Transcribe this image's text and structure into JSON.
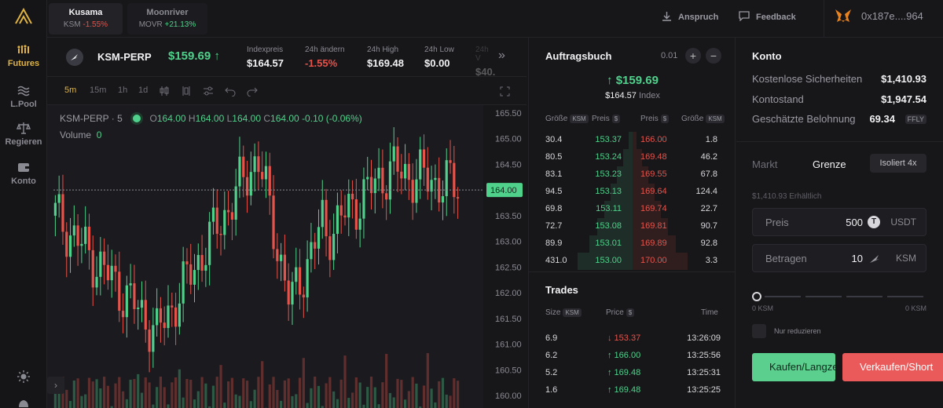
{
  "nav": {
    "futures": "Futures",
    "lpool": "L.Pool",
    "govern": "Regieren",
    "account": "Konto"
  },
  "markets": [
    {
      "name": "Kusama",
      "symbol": "KSM",
      "change": "-1.55%"
    },
    {
      "name": "Moonriver",
      "symbol": "MOVR",
      "change": "+21.13%"
    }
  ],
  "topbar": {
    "claim": "Anspruch",
    "feedback": "Feedback",
    "wallet": "0x187e....964"
  },
  "instrument": {
    "name": "KSM-PERP",
    "price": "$159.69",
    "stats": [
      {
        "label": "Indexpreis",
        "value": "$164.57"
      },
      {
        "label": "24h ändern",
        "value": "-1.55%"
      },
      {
        "label": "24h High",
        "value": "$169.48"
      },
      {
        "label": "24h Low",
        "value": "$0.00"
      },
      {
        "label": "24h V",
        "value": "$40."
      }
    ]
  },
  "chart_toolbar": {
    "timeframes": [
      "5m",
      "15m",
      "1h",
      "1d"
    ]
  },
  "chart": {
    "legend_title": "KSM-PERP · 5",
    "o": "164.00",
    "h": "164.00",
    "l": "164.00",
    "c": "164.00",
    "change": "-0.10 (-0.06%)",
    "volume_label": "Volume",
    "volume_value": "0",
    "current_price_label": "164.00"
  },
  "chart_data": {
    "type": "candlestick",
    "ylim": [
      160.0,
      165.5
    ],
    "yticks": [
      "165.50",
      "165.00",
      "164.50",
      "164.00",
      "163.50",
      "163.00",
      "162.50",
      "162.00",
      "161.50",
      "161.00",
      "160.50",
      "160.00"
    ],
    "last_price": 164.0
  },
  "orderbook": {
    "title": "Auftragsbuch",
    "tick": "0.01",
    "mid_price": "↑ $159.69",
    "index_price": "$164.57",
    "index_label": "Index",
    "headers": {
      "size": "Größe",
      "price": "Preis",
      "unit_ksm": "KSM",
      "unit_usd": "$"
    },
    "rows": [
      {
        "bid_size": "30.4",
        "bid_price": "153.37",
        "ask_price": "166.00",
        "ask_size": "1.8",
        "depth": 0.05
      },
      {
        "bid_size": "80.5",
        "bid_price": "153.24",
        "ask_price": "169.48",
        "ask_size": "46.2",
        "depth": 0.12
      },
      {
        "bid_size": "83.1",
        "bid_price": "153.23",
        "ask_price": "169.55",
        "ask_size": "67.8",
        "depth": 0.2
      },
      {
        "bid_size": "94.5",
        "bid_price": "153.13",
        "ask_price": "169.64",
        "ask_size": "124.4",
        "depth": 0.28
      },
      {
        "bid_size": "69.8",
        "bid_price": "153.11",
        "ask_price": "169.74",
        "ask_size": "22.7",
        "depth": 0.36
      },
      {
        "bid_size": "72.7",
        "bid_price": "153.08",
        "ask_price": "169.81",
        "ask_size": "90.7",
        "depth": 0.45
      },
      {
        "bid_size": "89.9",
        "bid_price": "153.01",
        "ask_price": "169.89",
        "ask_size": "92.8",
        "depth": 0.55
      },
      {
        "bid_size": "431.0",
        "bid_price": "153.00",
        "ask_price": "170.00",
        "ask_size": "3.3",
        "depth": 0.7
      }
    ]
  },
  "trades": {
    "title": "Trades",
    "headers": {
      "size": "Size",
      "unit": "KSM",
      "price": "Price",
      "price_unit": "$",
      "time": "Time"
    },
    "rows": [
      {
        "size": "6.9",
        "price": "↓ 153.37",
        "side": "sell",
        "time": "13:26:09"
      },
      {
        "size": "6.2",
        "price": "↑ 166.00",
        "side": "buy",
        "time": "13:25:56"
      },
      {
        "size": "5.2",
        "price": "↑ 169.48",
        "side": "buy",
        "time": "13:25:31"
      },
      {
        "size": "1.6",
        "price": "↑ 169.48",
        "side": "buy",
        "time": "13:25:25"
      }
    ]
  },
  "account": {
    "title": "Konto",
    "free_collateral_label": "Kostenlose Sicherheiten",
    "free_collateral": "$1,410.93",
    "balance_label": "Kontostand",
    "balance": "$1,947.54",
    "reward_label": "Geschätzte Belohnung",
    "reward": "69.34",
    "reward_token": "FFLY"
  },
  "order_form": {
    "tab_market": "Markt",
    "tab_limit": "Grenze",
    "margin_mode": "Isoliert 4x",
    "available": "$1,410.93 Erhältlich",
    "price_label": "Preis",
    "price_value": "500",
    "price_unit": "USDT",
    "amount_label": "Betragen",
    "amount_value": "10",
    "amount_unit": "KSM",
    "slider_min": "0 KSM",
    "slider_max": "0 KSM",
    "reduce_only": "Nur reduzieren",
    "buy_button": "Kaufen/Langzeit",
    "sell_button": "Verkaufen/Short",
    "colors": {
      "buy": "#5bd08e",
      "sell": "#ea5a5a",
      "accent": "#e0b341"
    }
  }
}
